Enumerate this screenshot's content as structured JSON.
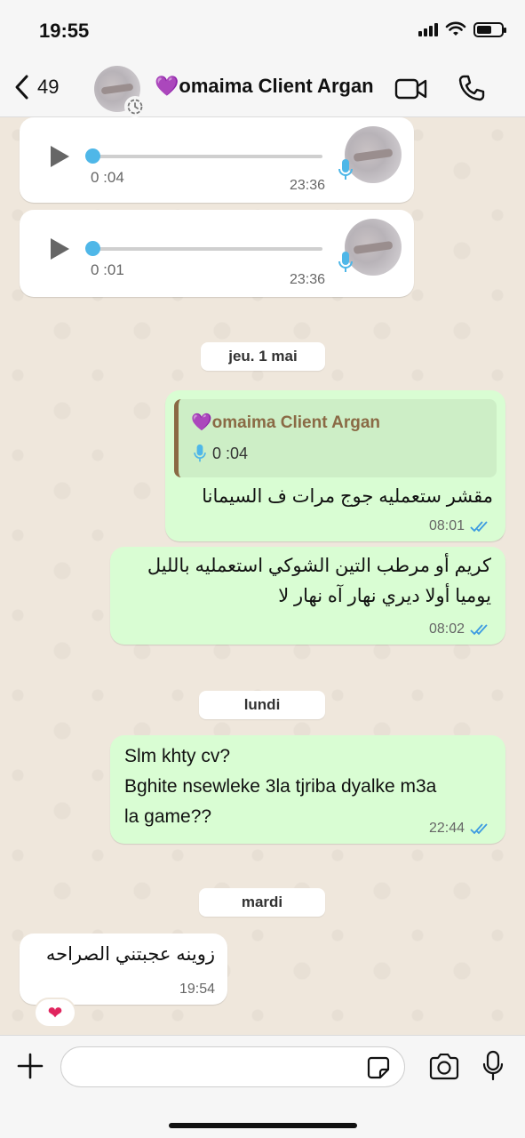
{
  "status_bar": {
    "time": "19:55"
  },
  "header": {
    "back_count": "49",
    "contact_name": "💜omaima Client Argan"
  },
  "messages": {
    "voice1": {
      "duration": "0 :04",
      "time": "23:36"
    },
    "voice2": {
      "duration": "0 :01",
      "time": "23:36"
    },
    "date1": "jeu. 1 mai",
    "reply1": {
      "quote_name": "💜omaima Client Argan",
      "quote_duration": "0 :04",
      "text": "مقشر ستعمليه جوج مرات ف السيمانا",
      "time": "08:01"
    },
    "msg2": {
      "line1": "كريم أو مرطب التين الشوكي استعمليه بالليل",
      "line2": "يوميا أولا ديري نهار آه نهار لا",
      "time": "08:02"
    },
    "date2": "lundi",
    "msg3": {
      "line1": "Slm khty cv?",
      "line2": "Bghite nsewleke 3la tjriba dyalke m3a",
      "line3": "la game??",
      "time": "22:44"
    },
    "date3": "mardi",
    "msg4": {
      "text": "زوينه عجبتني الصراحه",
      "time": "19:54"
    },
    "reaction": "❤"
  },
  "input": {
    "placeholder": ""
  },
  "colors": {
    "outgoing_bubble": "#d9fdd3",
    "incoming_bubble": "#ffffff",
    "read_ticks": "#3b9ae1",
    "chat_background": "#efe7dc"
  }
}
